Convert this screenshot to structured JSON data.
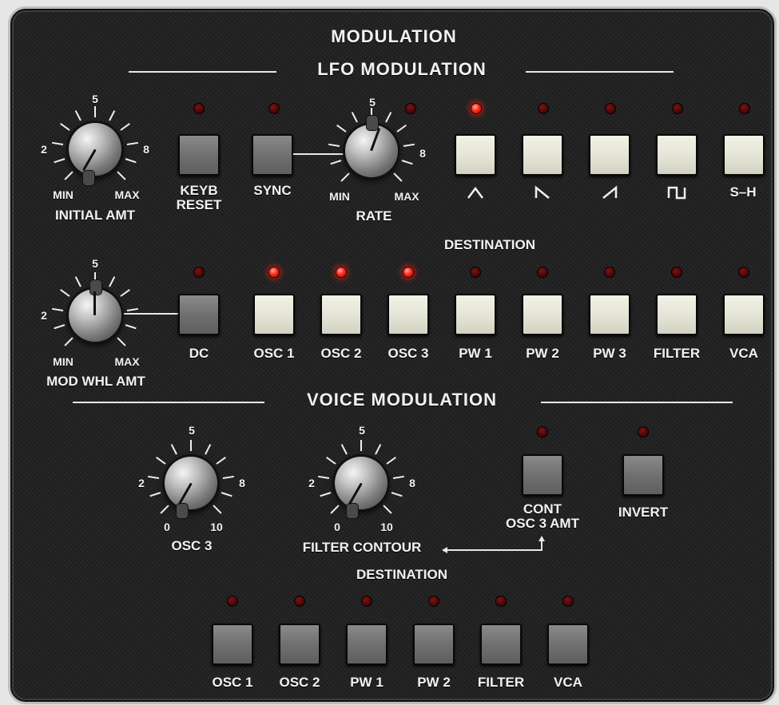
{
  "section_title": "MODULATION",
  "lfo": {
    "header": "LFO MODULATION",
    "initial_amt": {
      "label": "INITIAL AMT",
      "min": "MIN",
      "max": "MAX",
      "t2": "2",
      "t5": "5",
      "t8": "8"
    },
    "keyb_reset": "KEYB\nRESET",
    "sync": "SYNC",
    "rate": {
      "label": "RATE",
      "min": "MIN",
      "max": "MAX",
      "t5": "5",
      "t8": "8"
    },
    "waveforms": [
      "triangle",
      "saw-down",
      "saw-up",
      "square",
      "S-H"
    ],
    "sh_label": "S–H",
    "destination_label": "DESTINATION",
    "mod_whl": {
      "label": "MOD WHL AMT",
      "min": "MIN",
      "max": "MAX",
      "t2": "2",
      "t5": "5"
    },
    "dc": "DC",
    "destinations": [
      "OSC 1",
      "OSC 2",
      "OSC 3",
      "PW 1",
      "PW 2",
      "PW 3",
      "FILTER",
      "VCA"
    ]
  },
  "voice": {
    "header": "VOICE MODULATION",
    "osc3": {
      "label": "OSC 3",
      "t0": "0",
      "t2": "2",
      "t5": "5",
      "t8": "8",
      "t10": "10"
    },
    "filter_contour": {
      "label": "FILTER CONTOUR",
      "t0": "0",
      "t2": "2",
      "t5": "5",
      "t8": "8",
      "t10": "10"
    },
    "cont_osc3_amt": "CONT\nOSC 3 AMT",
    "invert": "INVERT",
    "destination_label": "DESTINATION",
    "destinations": [
      "OSC 1",
      "OSC 2",
      "PW 1",
      "PW 2",
      "FILTER",
      "VCA"
    ]
  },
  "leds": {
    "keyb_reset": false,
    "sync": false,
    "rate": false,
    "waveforms": [
      true,
      false,
      false,
      false,
      false
    ],
    "dc": false,
    "destinations": [
      true,
      true,
      true,
      false,
      false,
      false,
      false,
      false
    ],
    "cont_osc3_amt": false,
    "invert": false,
    "voice_destinations": [
      false,
      false,
      false,
      false,
      false,
      false
    ]
  },
  "colors": {
    "panel": "#1f1f1f",
    "led_on": "#ff2a1a",
    "led_off": "#4a0606",
    "text": "#f2f2f2"
  }
}
